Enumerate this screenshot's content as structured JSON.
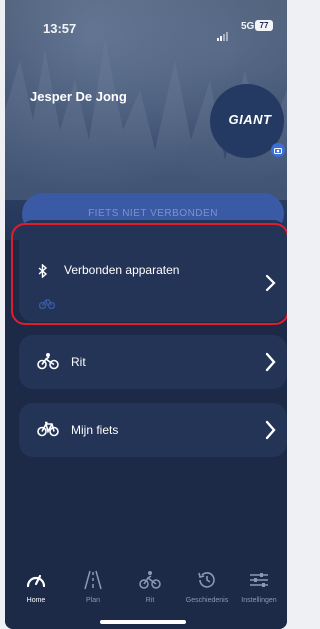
{
  "status_bar": {
    "time": "13:57",
    "network": "5G",
    "battery": "77"
  },
  "profile": {
    "name": "Jesper De Jong",
    "brand": "GIANT"
  },
  "connection_button": {
    "label": "FIETS NIET VERBONDEN"
  },
  "cards": {
    "devices": {
      "label": "Verbonden apparaten",
      "icon": "bluetooth-icon"
    },
    "ride": {
      "label": "Rit",
      "icon": "bike-icon"
    },
    "bike": {
      "label": "Mijn fiets",
      "icon": "bike-icon"
    }
  },
  "tabs": [
    {
      "label": "Home",
      "icon": "speedometer-icon",
      "active": true
    },
    {
      "label": "Plan",
      "icon": "road-icon",
      "active": false
    },
    {
      "label": "Rit",
      "icon": "bike-icon",
      "active": false
    },
    {
      "label": "Geschiedenis",
      "icon": "history-icon",
      "active": false
    },
    {
      "label": "Instellingen",
      "icon": "sliders-icon",
      "active": false
    }
  ],
  "colors": {
    "background": "#1c2a48",
    "card": "#243456",
    "button": "#3a5aa6",
    "highlight": "#e11d2a",
    "accent": "#3b6fd6"
  }
}
